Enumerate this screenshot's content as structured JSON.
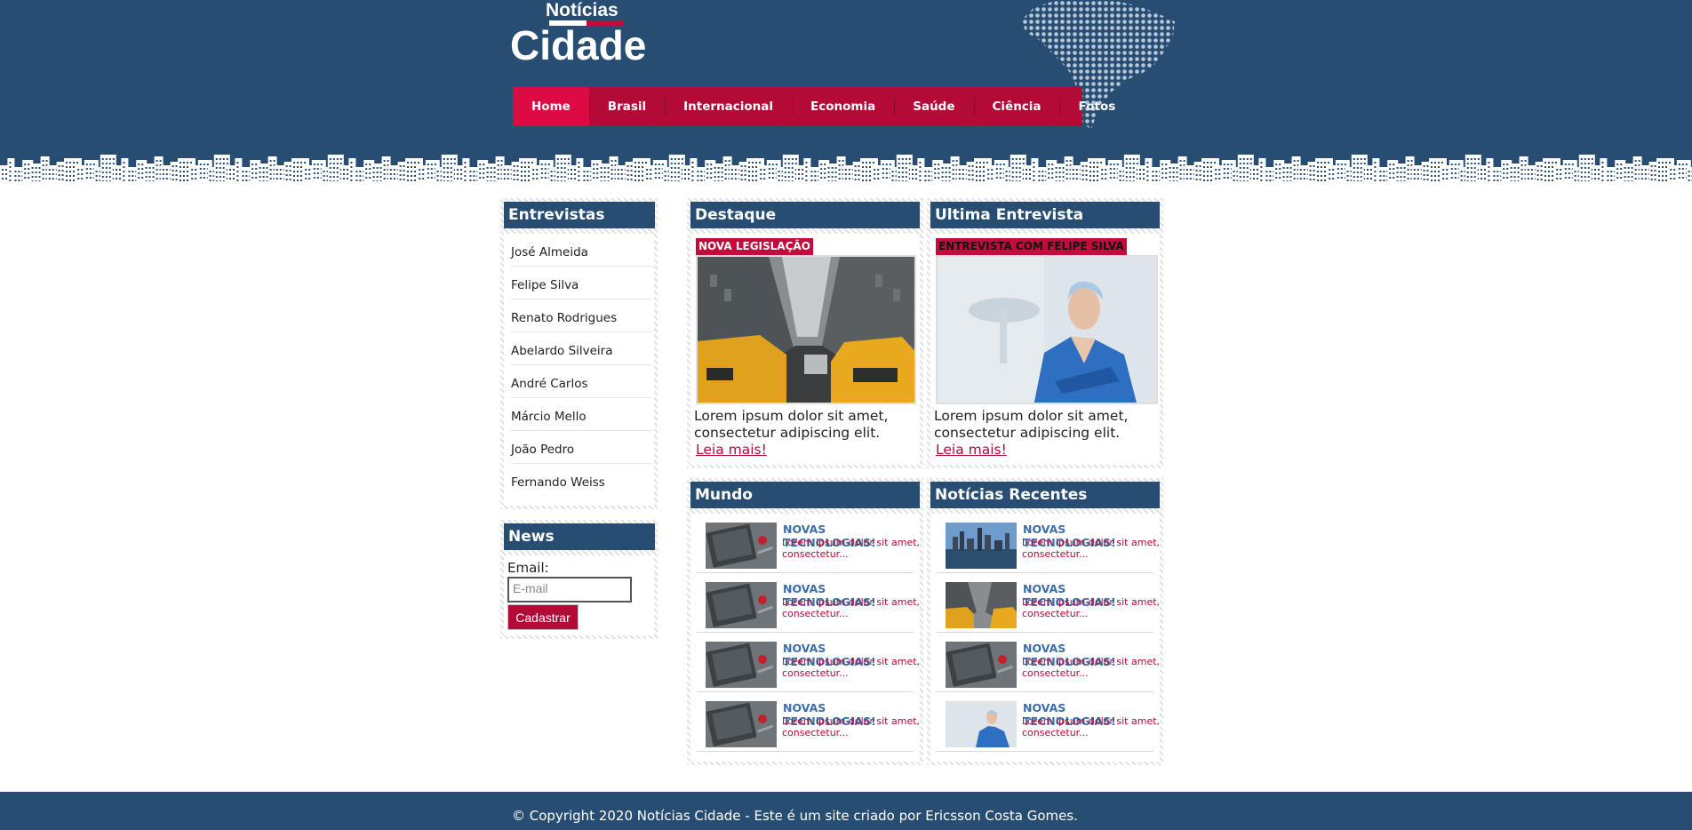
{
  "header": {
    "logo_small": "Notícias",
    "logo_big": "Cidade",
    "nav": [
      {
        "label": "Home",
        "active": true
      },
      {
        "label": "Brasil",
        "active": false
      },
      {
        "label": "Internacional",
        "active": false
      },
      {
        "label": "Economia",
        "active": false
      },
      {
        "label": "Saúde",
        "active": false
      },
      {
        "label": "Ciência",
        "active": false
      },
      {
        "label": "Fotos",
        "active": false
      }
    ]
  },
  "sidebar": {
    "entrevistas_title": "Entrevistas",
    "entrevistas": [
      "José Almeida",
      "Felipe Silva",
      "Renato Rodrigues",
      "Abelardo Silveira",
      "André Carlos",
      "Márcio Mello",
      "João Pedro",
      "Fernando Weiss"
    ],
    "news_title": "News",
    "email_label": "Email:",
    "email_placeholder": "E-mail",
    "submit_label": "Cadastrar"
  },
  "destaque": {
    "title": "Destaque",
    "tag": "NOVA LEGISLAÇÃO",
    "tag_text_color": "#ffffff",
    "caption": "Lorem ipsum dolor sit amet, consectetur adipiscing elit.",
    "link": "Leia mais!"
  },
  "entrevista": {
    "title": "Ultima Entrevista",
    "tag": "ENTREVISTA COM FELIPE SILVA",
    "tag_text_color": "#111111",
    "caption": "Lorem ipsum dolor sit amet, consectetur adipiscing elit.",
    "link": "Leia mais!"
  },
  "mundo": {
    "title": "Mundo",
    "items": [
      {
        "title": "NOVAS TECNOLOGIAS!",
        "text": "Lorem ipsum dolor sit amet, consectetur...",
        "thumb": "notebook"
      },
      {
        "title": "NOVAS TECNOLOGIAS!",
        "text": "Lorem ipsum dolor sit amet, consectetur...",
        "thumb": "notebook"
      },
      {
        "title": "NOVAS TECNOLOGIAS!",
        "text": "Lorem ipsum dolor sit amet, consectetur...",
        "thumb": "notebook"
      },
      {
        "title": "NOVAS TECNOLOGIAS!",
        "text": "Lorem ipsum dolor sit amet, consectetur...",
        "thumb": "notebook"
      }
    ]
  },
  "recentes": {
    "title": "Notícias Recentes",
    "items": [
      {
        "title": "NOVAS TECNOLOGIAS!",
        "text": "Lorem ipsum dolor sit amet, consectetur...",
        "thumb": "skyline"
      },
      {
        "title": "NOVAS TECNOLOGIAS!",
        "text": "Lorem ipsum dolor sit amet, consectetur...",
        "thumb": "taxi"
      },
      {
        "title": "NOVAS TECNOLOGIAS!",
        "text": "Lorem ipsum dolor sit amet, consectetur...",
        "thumb": "notebook"
      },
      {
        "title": "NOVAS TECNOLOGIAS!",
        "text": "Lorem ipsum dolor sit amet, consectetur...",
        "thumb": "doctor"
      }
    ]
  },
  "footer": {
    "text": "© Copyright 2020 Notícias Cidade - Este é um site criado por Ericsson Costa Gomes."
  },
  "colors": {
    "navy": "#284d73",
    "crimson": "#b30a37",
    "crimson_active": "#de0a44",
    "link_blue": "#3d6ea8"
  }
}
